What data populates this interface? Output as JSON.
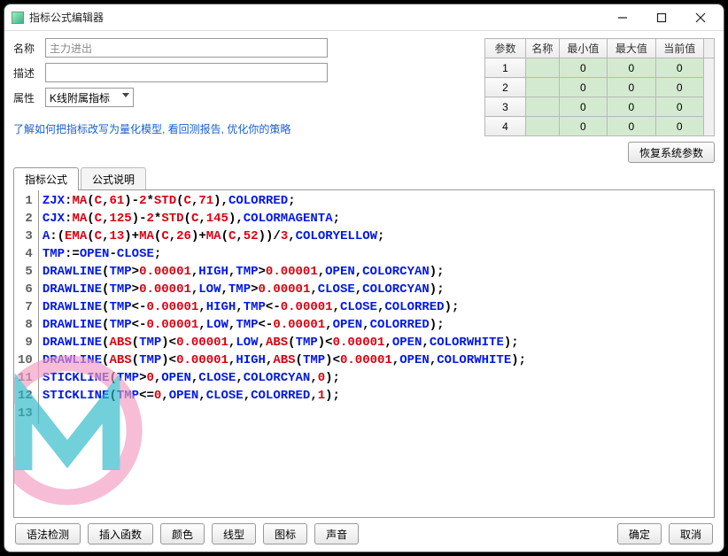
{
  "window": {
    "title": "指标公式编辑器"
  },
  "form": {
    "name_label": "名称",
    "name_value": "主力进出",
    "desc_label": "描述",
    "desc_value": "",
    "attr_label": "属性",
    "attr_value": "K线附属指标"
  },
  "link": "了解如何把指标改写为量化模型, 看回测报告, 优化你的策略",
  "params": {
    "headers": [
      "参数",
      "名称",
      "最小值",
      "最大值",
      "当前值"
    ],
    "rows": [
      {
        "idx": "1",
        "name": "",
        "min": "0",
        "max": "0",
        "cur": "0"
      },
      {
        "idx": "2",
        "name": "",
        "min": "0",
        "max": "0",
        "cur": "0"
      },
      {
        "idx": "3",
        "name": "",
        "min": "0",
        "max": "0",
        "cur": "0"
      },
      {
        "idx": "4",
        "name": "",
        "min": "0",
        "max": "0",
        "cur": "0"
      }
    ],
    "restore_btn": "恢复系统参数"
  },
  "tabs": {
    "formula": "指标公式",
    "desc": "公式说明"
  },
  "code_lines": [
    [
      [
        "ZJX",
        "blue"
      ],
      [
        ":",
        "blk"
      ],
      [
        "MA",
        "red"
      ],
      [
        "(",
        "blk"
      ],
      [
        "C",
        "red"
      ],
      [
        ",",
        "blk"
      ],
      [
        "61",
        "red"
      ],
      [
        ")-",
        "blk"
      ],
      [
        "2",
        "red"
      ],
      [
        "*",
        "blk"
      ],
      [
        "STD",
        "red"
      ],
      [
        "(",
        "blk"
      ],
      [
        "C",
        "red"
      ],
      [
        ",",
        "blk"
      ],
      [
        "71",
        "red"
      ],
      [
        "),",
        "blk"
      ],
      [
        "COLORRED",
        "blue"
      ],
      [
        ";",
        "blk"
      ]
    ],
    [
      [
        "CJX",
        "blue"
      ],
      [
        ":",
        "blk"
      ],
      [
        "MA",
        "red"
      ],
      [
        "(",
        "blk"
      ],
      [
        "C",
        "red"
      ],
      [
        ",",
        "blk"
      ],
      [
        "125",
        "red"
      ],
      [
        ")-",
        "blk"
      ],
      [
        "2",
        "red"
      ],
      [
        "*",
        "blk"
      ],
      [
        "STD",
        "red"
      ],
      [
        "(",
        "blk"
      ],
      [
        "C",
        "red"
      ],
      [
        ",",
        "blk"
      ],
      [
        "145",
        "red"
      ],
      [
        "),",
        "blk"
      ],
      [
        "COLORMAGENTA",
        "blue"
      ],
      [
        ";",
        "blk"
      ]
    ],
    [
      [
        "A",
        "blue"
      ],
      [
        ":(",
        "blk"
      ],
      [
        "EMA",
        "red"
      ],
      [
        "(",
        "blk"
      ],
      [
        "C",
        "red"
      ],
      [
        ",",
        "blk"
      ],
      [
        "13",
        "red"
      ],
      [
        ")+",
        "blk"
      ],
      [
        "MA",
        "red"
      ],
      [
        "(",
        "blk"
      ],
      [
        "C",
        "red"
      ],
      [
        ",",
        "blk"
      ],
      [
        "26",
        "red"
      ],
      [
        ")+",
        "blk"
      ],
      [
        "MA",
        "red"
      ],
      [
        "(",
        "blk"
      ],
      [
        "C",
        "red"
      ],
      [
        ",",
        "blk"
      ],
      [
        "52",
        "red"
      ],
      [
        "))/",
        "blk"
      ],
      [
        "3",
        "red"
      ],
      [
        ",",
        "blk"
      ],
      [
        "COLORYELLOW",
        "blue"
      ],
      [
        ";",
        "blk"
      ]
    ],
    [
      [
        "TMP",
        "blue"
      ],
      [
        ":=",
        "blk"
      ],
      [
        "OPEN",
        "blue"
      ],
      [
        "-",
        "blk"
      ],
      [
        "CLOSE",
        "blue"
      ],
      [
        ";",
        "blk"
      ]
    ],
    [
      [
        "DRAWLINE",
        "blue"
      ],
      [
        "(",
        "blk"
      ],
      [
        "TMP",
        "blue"
      ],
      [
        ">",
        "blk"
      ],
      [
        "0.00001",
        "red"
      ],
      [
        ",",
        "blk"
      ],
      [
        "HIGH",
        "blue"
      ],
      [
        ",",
        "blk"
      ],
      [
        "TMP",
        "blue"
      ],
      [
        ">",
        "blk"
      ],
      [
        "0.00001",
        "red"
      ],
      [
        ",",
        "blk"
      ],
      [
        "OPEN",
        "blue"
      ],
      [
        ",",
        "blk"
      ],
      [
        "COLORCYAN",
        "blue"
      ],
      [
        ");",
        "blk"
      ]
    ],
    [
      [
        "DRAWLINE",
        "blue"
      ],
      [
        "(",
        "blk"
      ],
      [
        "TMP",
        "blue"
      ],
      [
        ">",
        "blk"
      ],
      [
        "0.00001",
        "red"
      ],
      [
        ",",
        "blk"
      ],
      [
        "LOW",
        "blue"
      ],
      [
        ",",
        "blk"
      ],
      [
        "TMP",
        "blue"
      ],
      [
        ">",
        "blk"
      ],
      [
        "0.00001",
        "red"
      ],
      [
        ",",
        "blk"
      ],
      [
        "CLOSE",
        "blue"
      ],
      [
        ",",
        "blk"
      ],
      [
        "COLORCYAN",
        "blue"
      ],
      [
        ");",
        "blk"
      ]
    ],
    [
      [
        "DRAWLINE",
        "blue"
      ],
      [
        "(",
        "blk"
      ],
      [
        "TMP",
        "blue"
      ],
      [
        "<-",
        "blk"
      ],
      [
        "0.00001",
        "red"
      ],
      [
        ",",
        "blk"
      ],
      [
        "HIGH",
        "blue"
      ],
      [
        ",",
        "blk"
      ],
      [
        "TMP",
        "blue"
      ],
      [
        "<-",
        "blk"
      ],
      [
        "0.00001",
        "red"
      ],
      [
        ",",
        "blk"
      ],
      [
        "CLOSE",
        "blue"
      ],
      [
        ",",
        "blk"
      ],
      [
        "COLORRED",
        "blue"
      ],
      [
        ");",
        "blk"
      ]
    ],
    [
      [
        "DRAWLINE",
        "blue"
      ],
      [
        "(",
        "blk"
      ],
      [
        "TMP",
        "blue"
      ],
      [
        "<-",
        "blk"
      ],
      [
        "0.00001",
        "red"
      ],
      [
        ",",
        "blk"
      ],
      [
        "LOW",
        "blue"
      ],
      [
        ",",
        "blk"
      ],
      [
        "TMP",
        "blue"
      ],
      [
        "<-",
        "blk"
      ],
      [
        "0.00001",
        "red"
      ],
      [
        ",",
        "blk"
      ],
      [
        "OPEN",
        "blue"
      ],
      [
        ",",
        "blk"
      ],
      [
        "COLORRED",
        "blue"
      ],
      [
        ");",
        "blk"
      ]
    ],
    [
      [
        "DRAWLINE",
        "blue"
      ],
      [
        "(",
        "blk"
      ],
      [
        "ABS",
        "red"
      ],
      [
        "(",
        "blk"
      ],
      [
        "TMP",
        "blue"
      ],
      [
        ")<",
        "blk"
      ],
      [
        "0.00001",
        "red"
      ],
      [
        ",",
        "blk"
      ],
      [
        "LOW",
        "blue"
      ],
      [
        ",",
        "blk"
      ],
      [
        "ABS",
        "red"
      ],
      [
        "(",
        "blk"
      ],
      [
        "TMP",
        "blue"
      ],
      [
        ")<",
        "blk"
      ],
      [
        "0.00001",
        "red"
      ],
      [
        ",",
        "blk"
      ],
      [
        "OPEN",
        "blue"
      ],
      [
        ",",
        "blk"
      ],
      [
        "COLORWHITE",
        "blue"
      ],
      [
        ");",
        "blk"
      ]
    ],
    [
      [
        "DRAWLINE",
        "blue"
      ],
      [
        "(",
        "blk"
      ],
      [
        "ABS",
        "red"
      ],
      [
        "(",
        "blk"
      ],
      [
        "TMP",
        "blue"
      ],
      [
        ")<",
        "blk"
      ],
      [
        "0.00001",
        "red"
      ],
      [
        ",",
        "blk"
      ],
      [
        "HIGH",
        "blue"
      ],
      [
        ",",
        "blk"
      ],
      [
        "ABS",
        "red"
      ],
      [
        "(",
        "blk"
      ],
      [
        "TMP",
        "blue"
      ],
      [
        ")<",
        "blk"
      ],
      [
        "0.00001",
        "red"
      ],
      [
        ",",
        "blk"
      ],
      [
        "OPEN",
        "blue"
      ],
      [
        ",",
        "blk"
      ],
      [
        "COLORWHITE",
        "blue"
      ],
      [
        ");",
        "blk"
      ]
    ],
    [
      [
        "STICKLINE",
        "blue"
      ],
      [
        "(",
        "blk"
      ],
      [
        "TMP",
        "blue"
      ],
      [
        ">",
        "blk"
      ],
      [
        "0",
        "red"
      ],
      [
        ",",
        "blk"
      ],
      [
        "OPEN",
        "blue"
      ],
      [
        ",",
        "blk"
      ],
      [
        "CLOSE",
        "blue"
      ],
      [
        ",",
        "blk"
      ],
      [
        "COLORCYAN",
        "blue"
      ],
      [
        ",",
        "blk"
      ],
      [
        "0",
        "red"
      ],
      [
        ");",
        "blk"
      ]
    ],
    [
      [
        "STICKLINE",
        "blue"
      ],
      [
        "(",
        "blk"
      ],
      [
        "TMP",
        "blue"
      ],
      [
        "<=",
        "blk"
      ],
      [
        "0",
        "red"
      ],
      [
        ",",
        "blk"
      ],
      [
        "OPEN",
        "blue"
      ],
      [
        ",",
        "blk"
      ],
      [
        "CLOSE",
        "blue"
      ],
      [
        ",",
        "blk"
      ],
      [
        "COLORRED",
        "blue"
      ],
      [
        ",",
        "blk"
      ],
      [
        "1",
        "red"
      ],
      [
        ");",
        "blk"
      ]
    ],
    []
  ],
  "bottom_buttons": {
    "syntax": "语法检测",
    "insert_func": "插入函数",
    "color": "颜色",
    "line_style": "线型",
    "icon": "图标",
    "sound": "声音",
    "ok": "确定",
    "cancel": "取消"
  }
}
